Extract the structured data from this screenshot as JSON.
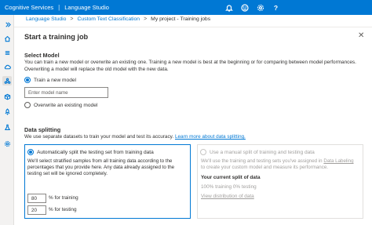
{
  "topbar": {
    "service": "Cognitive Services",
    "separator": "|",
    "app": "Language Studio",
    "icons": [
      "bell-icon",
      "smiley-icon",
      "gear-icon",
      "help-icon"
    ],
    "help_glyph": "?"
  },
  "rail": {
    "icons": [
      "collapse-icon",
      "home-icon",
      "list-icon",
      "cloud-icon",
      "model-icon",
      "box-icon",
      "rocket-icon",
      "flask-icon",
      "settings-icon"
    ]
  },
  "breadcrumb": {
    "items": [
      "Language Studio",
      "Custom Text Classification"
    ],
    "current": "My project - Training jobs",
    "chevron": ">"
  },
  "panel": {
    "title": "Start a training job",
    "close_glyph": "✕"
  },
  "select_model": {
    "heading": "Select Model",
    "description": "You can train a new model or overwrite an existing one. Training a new model is best at the beginning or for comparing between model performances. Overwriting a model will replace the old model with the new data.",
    "train_new_label": "Train a new model",
    "model_name_placeholder": "Enter model name",
    "overwrite_label": "Overwrite an existing model",
    "selected": "train_new"
  },
  "data_splitting": {
    "heading": "Data splitting",
    "description": "We use separate datasets to train your model and test its accuracy.",
    "learn_more": "Learn more about data splitting.",
    "auto": {
      "label": "Automatically split the testing set from training data",
      "body": "We'll select stratified samples from all training data according to the percentages that you provide here. Any data already assigned to the testing set will be ignored completely.",
      "training_value": "80",
      "training_label": "% for training",
      "testing_value": "20",
      "testing_label": "% for testing",
      "selected": true
    },
    "manual": {
      "label": "Use a manual split of training and testing data",
      "body_pre": "We'll use the training and testing sets you've assigned in",
      "body_link": "Data Labeling",
      "body_post": "to create your custom model and measure its performance.",
      "current_split_heading": "Your current split of data",
      "current_split_value": "100% training  0% testing",
      "view_distribution": "View distribution of data",
      "selected": false
    }
  },
  "colors": {
    "brand": "#0078d4",
    "rail_bg": "#f3f2f1",
    "text": "#323130",
    "disabled": "#a19f9d"
  }
}
